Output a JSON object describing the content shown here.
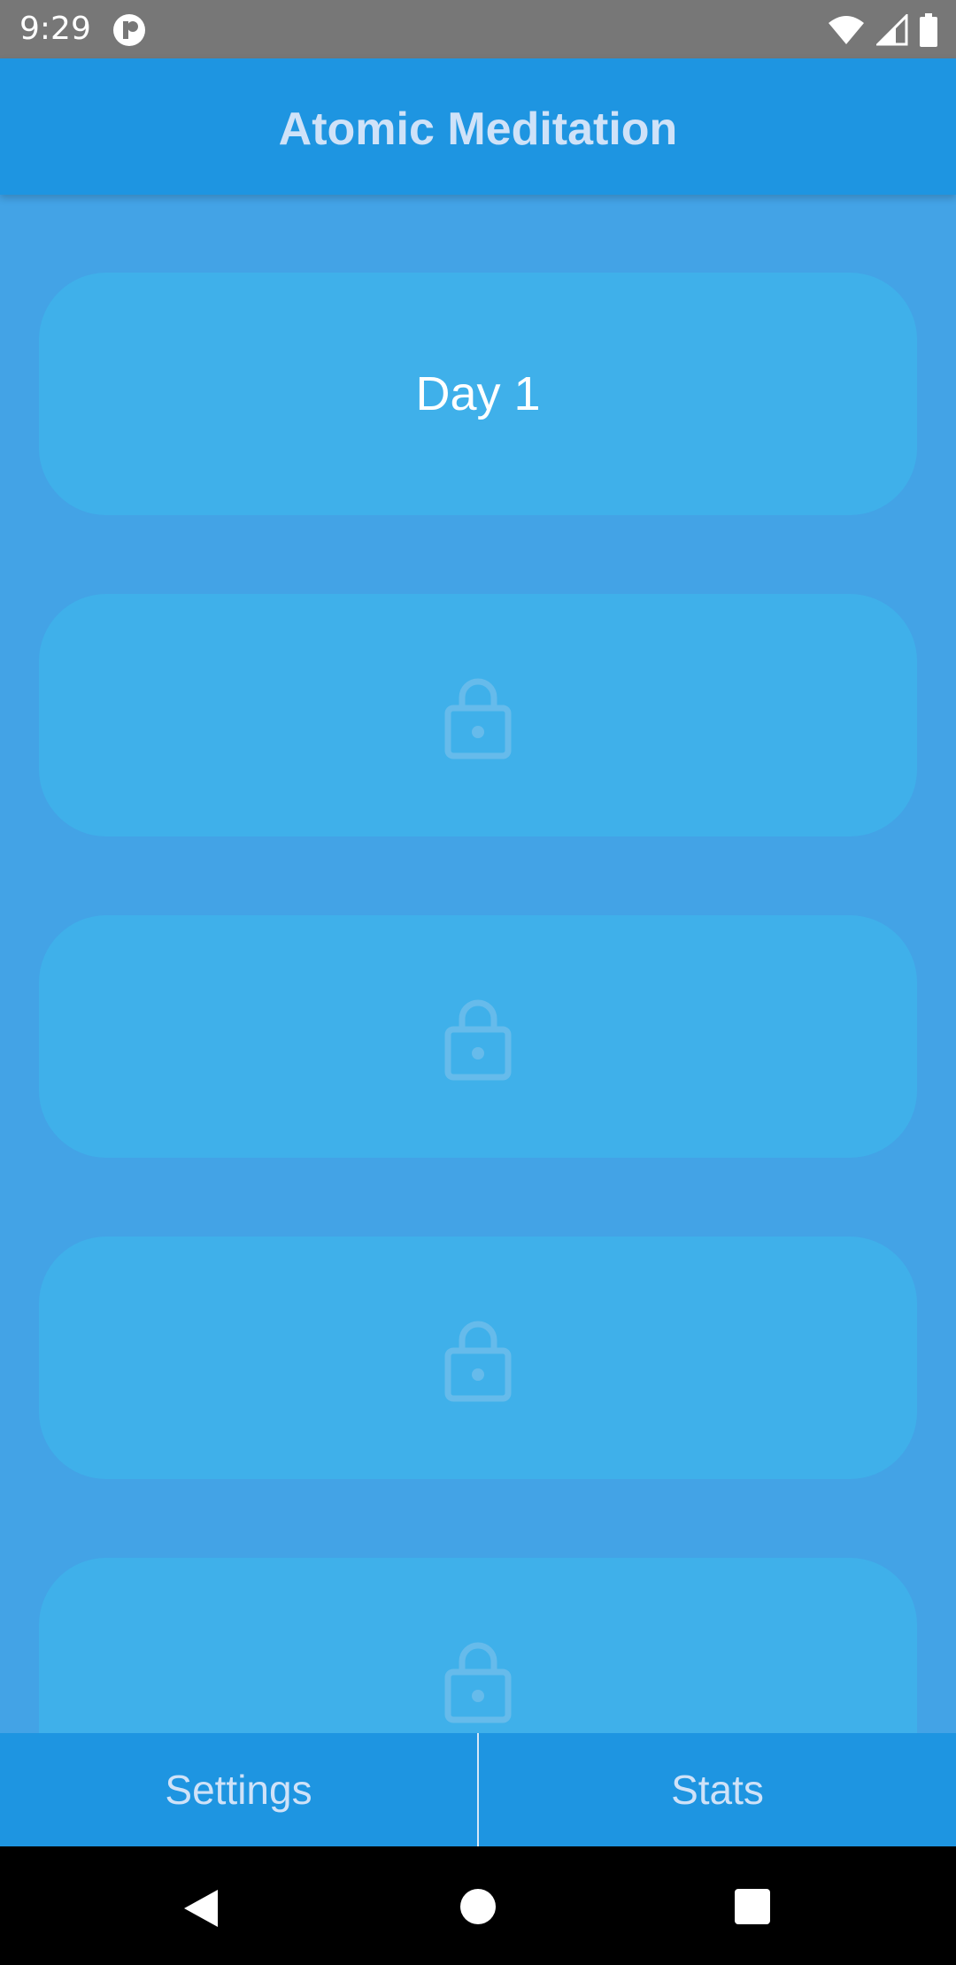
{
  "status_bar": {
    "time": "9:29",
    "icons": [
      "app-notification-icon",
      "wifi-icon",
      "signal-icon",
      "battery-icon"
    ]
  },
  "app_bar": {
    "title": "Atomic Meditation"
  },
  "days": [
    {
      "label": "Day 1",
      "locked": false
    },
    {
      "label": "",
      "locked": true,
      "icon": "lock-icon"
    },
    {
      "label": "",
      "locked": true,
      "icon": "lock-icon"
    },
    {
      "label": "",
      "locked": true,
      "icon": "lock-icon"
    },
    {
      "label": "",
      "locked": true,
      "icon": "lock-icon"
    }
  ],
  "bottom_nav": {
    "settings_label": "Settings",
    "stats_label": "Stats"
  },
  "system_nav": {
    "buttons": [
      "back-icon",
      "home-icon",
      "recents-icon"
    ]
  },
  "colors": {
    "app_bar": "#1E95E1",
    "background": "#43A3E6",
    "card": "#3FB0EA",
    "lock": "#66BBEB",
    "title_text": "#CFE2F8"
  }
}
